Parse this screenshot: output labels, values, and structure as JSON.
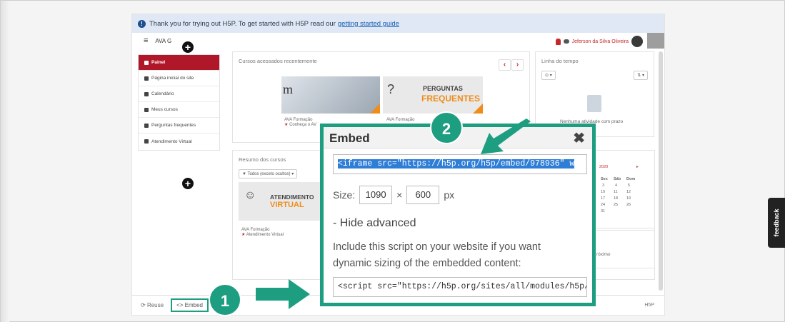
{
  "notice": {
    "text": "Thank you for trying out H5P. To get started with H5P read our",
    "link": "getting started guide"
  },
  "topbar": {
    "site_name": "AVA      G",
    "user_name": "Jeferson da Silva Oliveira"
  },
  "sidebar": {
    "items": [
      {
        "label": "Painel"
      },
      {
        "label": "Página inicial do site"
      },
      {
        "label": "Calendário"
      },
      {
        "label": "Meus cursos"
      },
      {
        "label": "Perguntas frequentes"
      },
      {
        "label": "Atendimento Virtual"
      }
    ]
  },
  "recent_courses": {
    "title": "Cursos acessados recentemente",
    "courses": [
      {
        "category": "AVA Formação",
        "name": "Conheça o AV"
      },
      {
        "category": "AVA Formação",
        "name": ""
      }
    ],
    "faq_tile": {
      "line1": "PERGUNTAS",
      "line2": "FREQUENTES"
    }
  },
  "timeline": {
    "title": "Linha do tempo",
    "empty_text": "Nenhuma atividade com prazo"
  },
  "summary": {
    "title": "Resumo dos cursos",
    "filter": "Todos (exceto ocultos)",
    "tile": {
      "line1": "ATENDIMENTO",
      "line2": "VIRTUAL"
    },
    "course": {
      "category": "AVA Formação",
      "name": "Atendimento Virtual"
    }
  },
  "calendar": {
    "year_fragment": "2020",
    "headers": [
      "Sex",
      "Sáb",
      "Dom"
    ],
    "rows": [
      [
        "3",
        "4",
        "5"
      ],
      [
        "10",
        "11",
        "12"
      ],
      [
        "17",
        "18",
        "19"
      ],
      [
        "24",
        "25",
        "26"
      ],
      [
        "31",
        "",
        ""
      ]
    ],
    "upcoming_fragment": "róximo"
  },
  "footer": {
    "reuse": "Reuse",
    "embed": "<> Embed",
    "h5p": "H5P"
  },
  "dialog": {
    "title": "Embed",
    "close": "✖",
    "iframe_code": "<iframe src=\"https://h5p.org/h5p/embed/978936\" w",
    "size_label": "Size:",
    "width": "1090",
    "times": "×",
    "height": "600",
    "unit": "px",
    "advanced_toggle": "-  Hide advanced",
    "advanced_text": "Include this script on your website if you want dynamic sizing of the embedded content:",
    "script_code": "<script src=\"https://h5p.org/sites/all/modules/h5p/li"
  },
  "steps": {
    "one": "1",
    "two": "2"
  },
  "feedback": "feedback",
  "colors": {
    "accent": "#1e9e81",
    "brand_red": "#b0182a",
    "faq_orange": "#f08c1a",
    "selection_blue": "#2e7dd7"
  }
}
